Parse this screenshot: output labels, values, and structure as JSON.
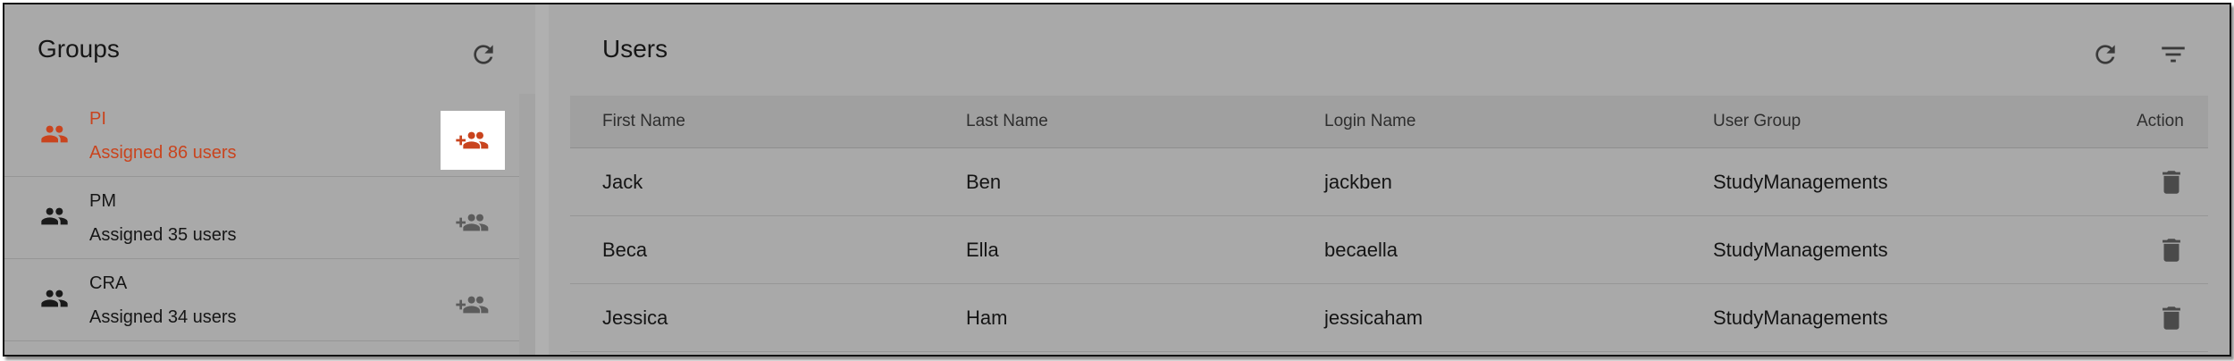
{
  "groups": {
    "title": "Groups",
    "items": [
      {
        "name": "PI",
        "count_text": "Assigned 86 users",
        "active": true
      },
      {
        "name": "PM",
        "count_text": "Assigned 35 users",
        "active": false
      },
      {
        "name": "CRA",
        "count_text": "Assigned 34 users",
        "active": false
      }
    ]
  },
  "users": {
    "title": "Users",
    "columns": [
      "First Name",
      "Last Name",
      "Login Name",
      "User Group",
      "Action"
    ],
    "rows": [
      [
        "Jack",
        "Ben",
        "jackben",
        "StudyManagements"
      ],
      [
        "Beca",
        "Ella",
        "becaella",
        "StudyManagements"
      ],
      [
        "Jessica",
        "Ham",
        "jessicaham",
        "StudyManagements"
      ]
    ]
  },
  "icons": {
    "groups_refresh": "refresh-icon",
    "users_refresh": "refresh-icon",
    "users_filter": "filter-icon",
    "group": "group-icon",
    "assign": "group-add-icon",
    "delete": "trash-icon"
  },
  "colors": {
    "accent": "#c9441e",
    "icon": "#3a3a3a",
    "icon_muted": "#5c5c5c",
    "panel": "#a9a9a9"
  }
}
